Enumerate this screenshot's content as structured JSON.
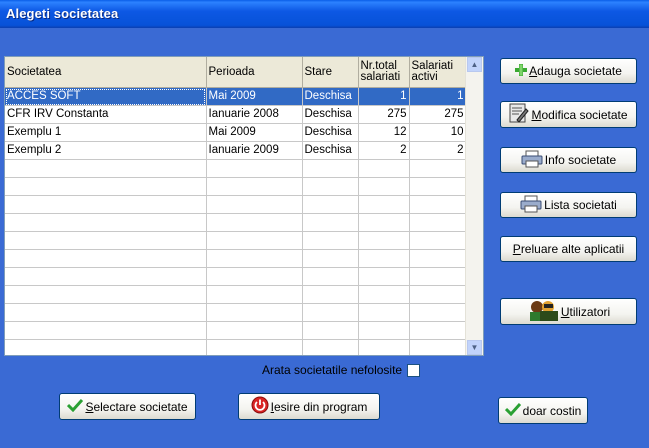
{
  "window": {
    "title": "Alegeti societatea"
  },
  "grid": {
    "columns": [
      "Societatea",
      "Perioada",
      "Stare",
      "Nr.total salariati",
      "Salariati activi"
    ],
    "rows": [
      [
        "ACCES SOFT",
        "Mai 2009",
        "Deschisa",
        "1",
        "1"
      ],
      [
        "CFR IRV Constanta",
        "Ianuarie 2008",
        "Deschisa",
        "275",
        "275"
      ],
      [
        "Exemplu 1",
        "Mai 2009",
        "Deschisa",
        "12",
        "10"
      ],
      [
        "Exemplu 2",
        "Ianuarie 2009",
        "Deschisa",
        "2",
        "2"
      ]
    ],
    "selected_row": 0
  },
  "buttons": {
    "add": {
      "prefix": "",
      "ul": "A",
      "rest": "dauga societate"
    },
    "edit": {
      "prefix": "",
      "ul": "M",
      "rest": "odifica societate"
    },
    "info": {
      "prefix": "Info societate",
      "ul": "",
      "rest": ""
    },
    "list": {
      "prefix": "Lista societati",
      "ul": "",
      "rest": ""
    },
    "import": {
      "prefix": "",
      "ul": "P",
      "rest": "reluare alte aplicatii"
    },
    "users": {
      "prefix": "",
      "ul": "U",
      "rest": "tilizatori"
    },
    "select": {
      "prefix": "",
      "ul": "S",
      "rest": "electare societate"
    },
    "exit": {
      "prefix": "",
      "ul": "I",
      "rest": "esire din program"
    },
    "only": {
      "prefix": "doar costin",
      "ul": "",
      "rest": ""
    }
  },
  "checkbox": {
    "label": "Arata societatile nefolosite",
    "checked": false
  },
  "colors": {
    "background": "#3a6ad4",
    "selection": "#316ac5",
    "title_bar": "#0752d8"
  }
}
